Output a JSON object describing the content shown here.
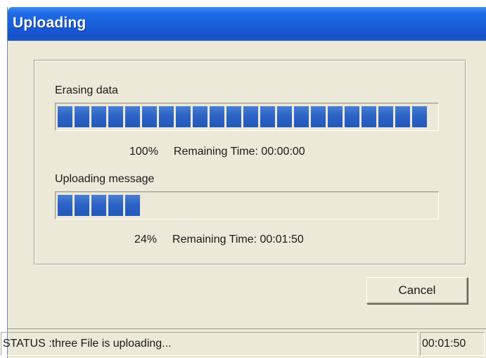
{
  "window": {
    "title": "Uploading"
  },
  "tasks": [
    {
      "label": "Erasing data",
      "progress_fraction": 1.0,
      "percent_text": "100%",
      "remaining_text": "Remaining Time: 00:00:00"
    },
    {
      "label": "Uploading message",
      "progress_fraction": 0.24,
      "percent_text": "24%",
      "remaining_text": "Remaining Time: 00:01:50"
    }
  ],
  "buttons": {
    "cancel_label": "Cancel"
  },
  "statusbar": {
    "message": "STATUS :three File is uploading...",
    "time": "00:01:50"
  },
  "colors": {
    "title_bar": "#1a5fda",
    "progress_block": "#2c63c6",
    "window_background": "#ece9d8"
  }
}
